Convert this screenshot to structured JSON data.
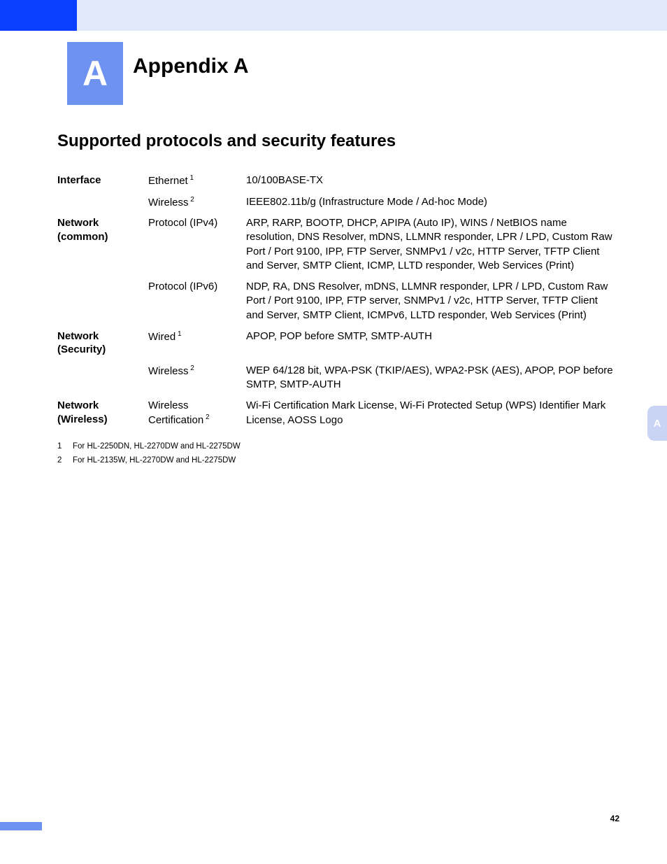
{
  "header": {
    "letter": "A",
    "title": "Appendix A"
  },
  "section_title": "Supported protocols and security features",
  "rows": [
    {
      "group": "Interface",
      "label": "Ethernet",
      "sup": "1",
      "value": "10/100BASE-TX"
    },
    {
      "group": "",
      "label": "Wireless",
      "sup": "2",
      "value": "IEEE802.11b/g (Infrastructure Mode / Ad-hoc Mode)"
    },
    {
      "group": "Network (common)",
      "label": "Protocol (IPv4)",
      "sup": "",
      "value": "ARP, RARP, BOOTP, DHCP, APIPA (Auto IP), WINS / NetBIOS name resolution, DNS Resolver, mDNS, LLMNR responder, LPR / LPD, Custom Raw Port / Port 9100, IPP, FTP Server, SNMPv1 / v2c, HTTP Server, TFTP Client and Server, SMTP Client, ICMP, LLTD responder, Web Services (Print)"
    },
    {
      "group": "",
      "label": "Protocol (IPv6)",
      "sup": "",
      "value": "NDP, RA, DNS Resolver, mDNS, LLMNR responder, LPR / LPD, Custom Raw Port / Port 9100, IPP, FTP server, SNMPv1 / v2c, HTTP Server, TFTP Client and Server, SMTP Client, ICMPv6, LLTD responder, Web Services (Print)"
    },
    {
      "group": "Network (Security)",
      "label": "Wired",
      "sup": "1",
      "value": "APOP, POP before SMTP, SMTP-AUTH"
    },
    {
      "group": "",
      "label": "Wireless",
      "sup": "2",
      "value": "WEP 64/128 bit, WPA-PSK (TKIP/AES), WPA2-PSK (AES), APOP, POP before SMTP, SMTP-AUTH"
    },
    {
      "group": "Network (Wireless)",
      "label": "Wireless Certification",
      "sup": "2",
      "value": "Wi-Fi Certification Mark License, Wi-Fi Protected Setup (WPS) Identifier Mark License, AOSS Logo"
    }
  ],
  "footnotes": [
    {
      "num": "1",
      "text": "For HL-2250DN, HL-2270DW and HL-2275DW"
    },
    {
      "num": "2",
      "text": "For HL-2135W, HL-2270DW and HL-2275DW"
    }
  ],
  "side_tab": "A",
  "page_number": "42"
}
